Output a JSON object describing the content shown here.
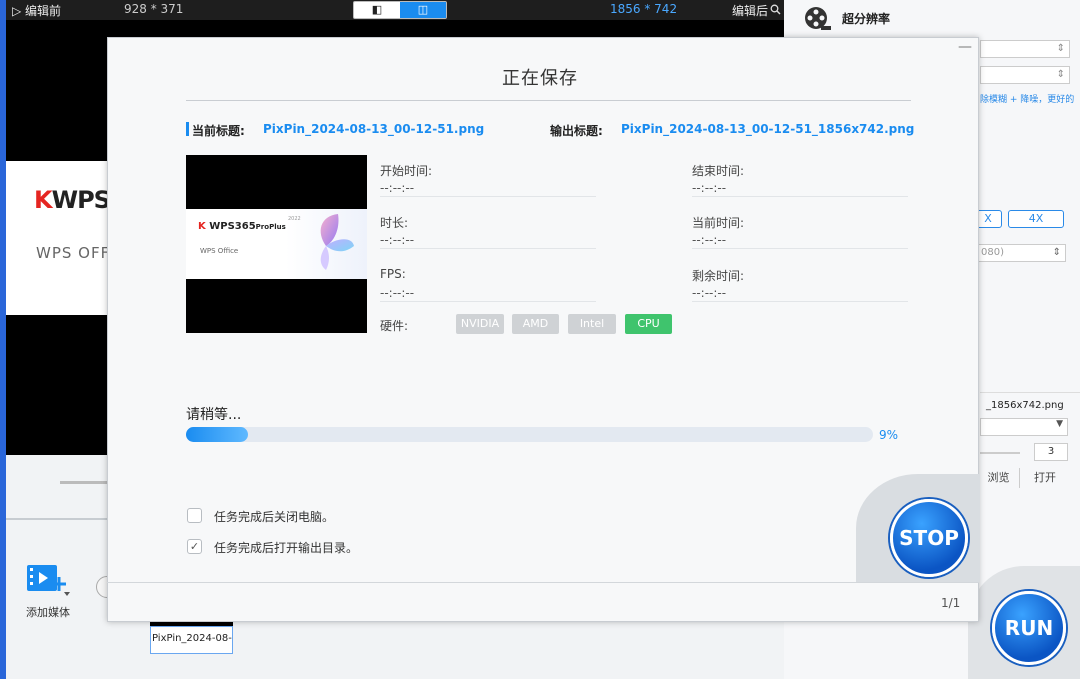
{
  "background_app": {
    "topbar": {
      "before_label": "▷ 编辑前",
      "before_size": "928 * 371",
      "after_size": "1856 * 742",
      "after_label": "编辑后",
      "view_single": "◧",
      "view_split": "◫"
    },
    "preview": {
      "logo_k": "K",
      "logo_text": "WPS",
      "office_text": "WPS OFF"
    },
    "add_media_label": "添加媒体",
    "thumb_name": "PixPin_2024-08-",
    "right_panel": {
      "title": "超分辨率",
      "hint": "除模糊 + 降噪，更好的",
      "btn_x": "X",
      "btn_4x": "4X",
      "resolution": "080)",
      "output_file": "_1856x742.png",
      "count": "3",
      "browse": "浏览",
      "open": "打开",
      "run_label": "RUN"
    }
  },
  "modal": {
    "title": "正在保存",
    "minimize_glyph": "—",
    "current_title_label": "当前标题:",
    "current_title_value": "PixPin_2024-08-13_00-12-51.png",
    "output_title_label": "输出标题:",
    "output_title_value": "PixPin_2024-08-13_00-12-51_1856x742.png",
    "preview": {
      "logo_k": "K",
      "logo_text": "WPS365",
      "logo_suffix": "ProPlus",
      "year": "2022",
      "office_text": "WPS Office"
    },
    "info": {
      "start_time_label": "开始时间:",
      "start_time_value": "--:--:--",
      "end_time_label": "结束时间:",
      "end_time_value": "--:--:--",
      "duration_label": "时长:",
      "duration_value": "--:--:--",
      "current_time_label": "当前时间:",
      "current_time_value": "--:--:--",
      "fps_label": "FPS:",
      "fps_value": "--:--:--",
      "remaining_time_label": "剩余时间:",
      "remaining_time_value": "--:--:--",
      "hardware_label": "硬件:"
    },
    "hardware_options": [
      {
        "label": "NVIDIA",
        "active": false
      },
      {
        "label": "AMD",
        "active": false
      },
      {
        "label": "Intel",
        "active": false
      },
      {
        "label": "CPU",
        "active": true
      }
    ],
    "status_text": "请稍等...",
    "progress_percent": 9,
    "progress_label": "9%",
    "options": {
      "shutdown_label": "任务完成后关闭电脑。",
      "shutdown_checked": false,
      "open_dir_label": "任务完成后打开输出目录。",
      "open_dir_checked": true
    },
    "stop_label": "STOP",
    "page_counter": "1/1"
  },
  "colors": {
    "accent": "#1a8cf0",
    "active_hw": "#3fc46d",
    "inactive_hw": "#cfd2d5",
    "stop_run_blue": "#0b55c4"
  },
  "icons": {
    "minimize": "minimize-icon",
    "check": "check-icon",
    "film": "film-reel-icon",
    "add_media": "add-media-icon",
    "search": "search-icon"
  }
}
